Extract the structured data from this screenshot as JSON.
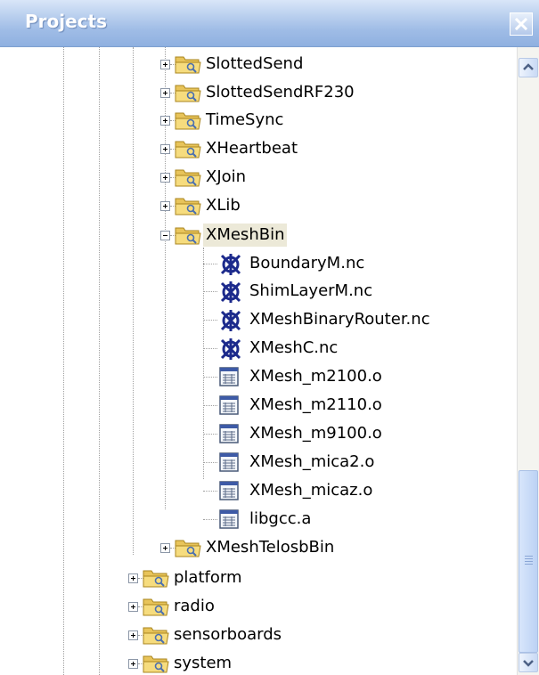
{
  "panel": {
    "title": "Projects"
  },
  "tree": {
    "items": [
      {
        "label": "SlottedSend",
        "type": "folder",
        "expanded": false
      },
      {
        "label": "SlottedSendRF230",
        "type": "folder",
        "expanded": false
      },
      {
        "label": "TimeSync",
        "type": "folder",
        "expanded": false
      },
      {
        "label": "XHeartbeat",
        "type": "folder",
        "expanded": false
      },
      {
        "label": "XJoin",
        "type": "folder",
        "expanded": false
      },
      {
        "label": "XLib",
        "type": "folder",
        "expanded": false
      },
      {
        "label": "XMeshBin",
        "type": "folder",
        "expanded": true,
        "selected": true
      },
      {
        "label": "BoundaryM.nc",
        "type": "nc-file"
      },
      {
        "label": "ShimLayerM.nc",
        "type": "nc-file"
      },
      {
        "label": "XMeshBinaryRouter.nc",
        "type": "nc-file"
      },
      {
        "label": "XMeshC.nc",
        "type": "nc-file"
      },
      {
        "label": "XMesh_m2100.o",
        "type": "object-file"
      },
      {
        "label": "XMesh_m2110.o",
        "type": "object-file"
      },
      {
        "label": "XMesh_m9100.o",
        "type": "object-file"
      },
      {
        "label": "XMesh_mica2.o",
        "type": "object-file"
      },
      {
        "label": "XMesh_micaz.o",
        "type": "object-file"
      },
      {
        "label": "libgcc.a",
        "type": "object-file"
      },
      {
        "label": "XMeshTelosbBin",
        "type": "folder",
        "expanded": false
      },
      {
        "label": "platform",
        "type": "folder",
        "expanded": false
      },
      {
        "label": "radio",
        "type": "folder",
        "expanded": false
      },
      {
        "label": "sensorboards",
        "type": "folder",
        "expanded": false
      },
      {
        "label": "system",
        "type": "folder",
        "expanded": false
      }
    ]
  },
  "icons": {
    "close": "close-icon",
    "scroll_up": "scroll-up-arrow-icon",
    "scroll_down": "scroll-down-arrow-icon",
    "folder": "folder-icon",
    "nc_file": "nesc-file-icon",
    "object_file": "object-file-icon"
  },
  "colors": {
    "titlebar": "#a8c2ea",
    "selection": "#ece9d8",
    "scrollbar_thumb": "#c6d8f6"
  },
  "scrollbar": {
    "position": 0.84
  }
}
